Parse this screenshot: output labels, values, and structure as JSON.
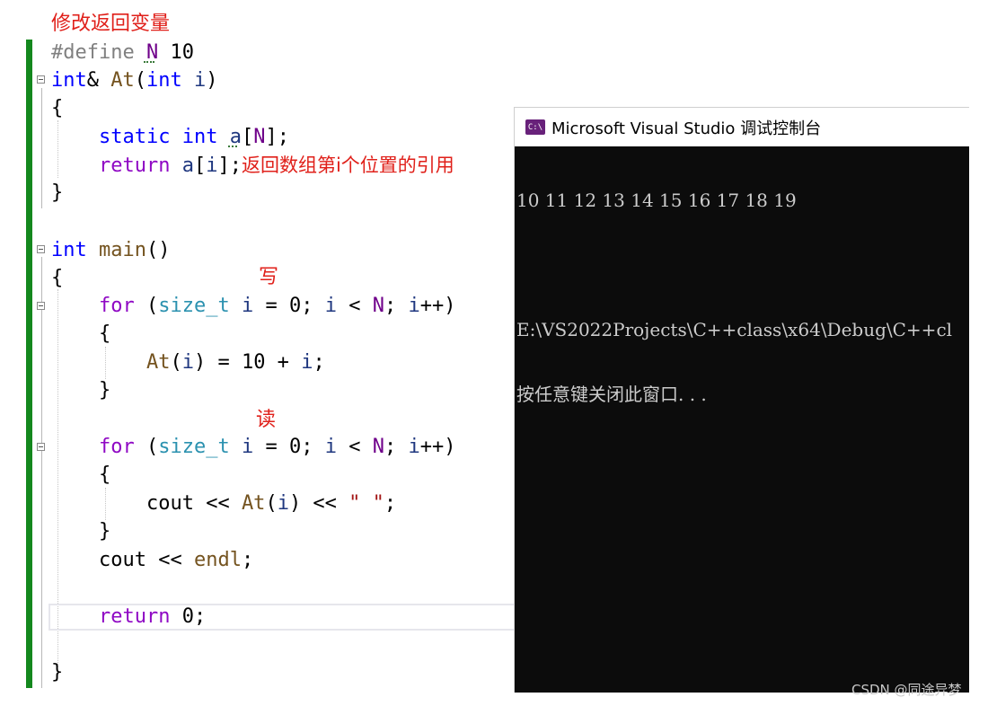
{
  "annotations": {
    "heading": "修改返回变量",
    "write_label": "写",
    "read_label": "读",
    "inline_note": "返回数组第i个位置的引用"
  },
  "code": {
    "l1_pp": "#define",
    "l1_macro": "N",
    "l1_val": "10",
    "l2_type": "int",
    "l2_amp": "& ",
    "l2_fn": "At",
    "l2_open": "(",
    "l2_ptype": "int",
    "l2_param": "i",
    "l2_close": ")",
    "l3": "{",
    "l4_static": "static",
    "l4_int": "int",
    "l4_arr": "a",
    "l4_ob": "[",
    "l4_N": "N",
    "l4_rest": "];",
    "l5_return": "return",
    "l5_a": "a",
    "l5_ob": "[",
    "l5_i": "i",
    "l5_rest": "];",
    "l6": "}",
    "l8_int": "int",
    "l8_main": "main",
    "l8_paren": "()",
    "l9": "{",
    "l10_for": "for",
    "l10_p1": " (",
    "l10_type": "size_t",
    "l10_i1": "i",
    "l10_p2": " = 0; ",
    "l10_i2": "i",
    "l10_p3": " < ",
    "l10_N": "N",
    "l10_p4": "; ",
    "l10_i3": "i",
    "l10_p5": "++)",
    "l11": "{",
    "l12_fn": "At",
    "l12_p1": "(",
    "l12_i": "i",
    "l12_p2": ") = 10 + ",
    "l12_i2": "i",
    "l12_p3": ";",
    "l13": "}",
    "l15_for": "for",
    "l15_p1": " (",
    "l15_type": "size_t",
    "l15_i1": "i",
    "l15_p2": " = 0; ",
    "l15_i2": "i",
    "l15_p3": " < ",
    "l15_N": "N",
    "l15_p4": "; ",
    "l15_i3": "i",
    "l15_p5": "++)",
    "l16": "{",
    "l17_cout": "cout",
    "l17_p1": " << ",
    "l17_fn": "At",
    "l17_p2": "(",
    "l17_i": "i",
    "l17_p3": ") << ",
    "l17_str": "\" \"",
    "l17_p4": ";",
    "l18": "}",
    "l19_cout": "cout",
    "l19_p1": " << ",
    "l19_endl": "endl",
    "l19_p2": ";",
    "l21_return": "return",
    "l21_rest": " 0;",
    "l23": "}"
  },
  "console": {
    "title": "Microsoft Visual Studio 调试控制台",
    "icon_text": "C:\\",
    "output_line": "10 11 12 13 14 15 16 17 18 19",
    "path_line": "E:\\VS2022Projects\\C++class\\x64\\Debug\\C++cl",
    "prompt_line": "按任意键关闭此窗口. . ."
  },
  "watermark": "CSDN @同途异梦",
  "colors": {
    "keyword": "#0000ff",
    "control": "#8f08c4",
    "function": "#74531f",
    "type": "#2b91af",
    "macro": "#6f008a",
    "annotation": "#e0201a",
    "change_bar": "#14881e",
    "console_bg": "#0c0c0c"
  }
}
